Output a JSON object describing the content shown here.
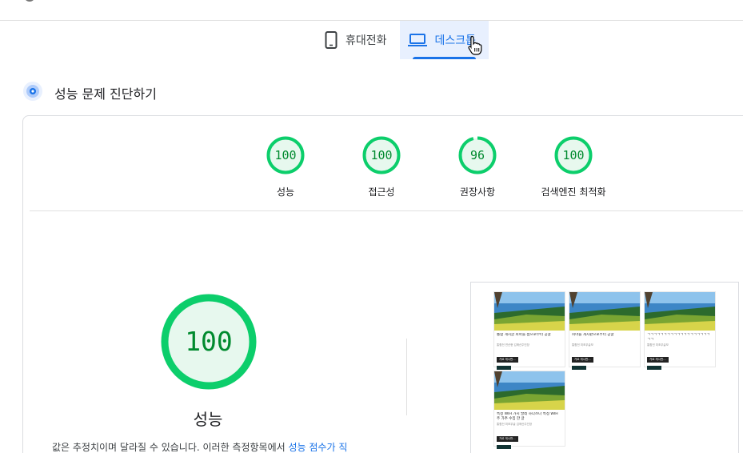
{
  "device_tabs": [
    {
      "label": "휴대전화",
      "icon": "smartphone-icon",
      "active": false
    },
    {
      "label": "데스크톱",
      "icon": "laptop-icon",
      "active": true
    }
  ],
  "diagnose": {
    "label": "성능 문제 진단하기",
    "icon": "lighthouse-radar-icon"
  },
  "categories": [
    {
      "name": "성능",
      "score": "100",
      "value": 100
    },
    {
      "name": "접근성",
      "score": "100",
      "value": 100
    },
    {
      "name": "권장사항",
      "score": "96",
      "value": 96
    },
    {
      "name": "검색엔진 최적화",
      "score": "100",
      "value": 100
    }
  ],
  "main_score": {
    "score": "100",
    "title": "성능",
    "value": 100
  },
  "note": {
    "text": "값은 추정치이며 달라질 수 있습니다. 이러한 측정항목에서 ",
    "link": "성능 점수가 직"
  },
  "screenshot": {
    "posts": [
      {
        "title": "통합 게시글 피마들 섬으로부터 공굴",
        "meta": "통합전 연산현 김매산주인장",
        "tag": "가르 게시판..."
      },
      {
        "title": "피마들 게시판으로부터 공굴",
        "meta": "통합전 미조우글모",
        "tag": "가르 게시판..."
      },
      {
        "title": "ㄱㄱㄱㄱㄱㄱㄱㄱㄱㄱㄱㄱㄱㄱㄱㄱㄱㄱㄱ ㄱㄱ",
        "meta": "통합전 미조우글모",
        "tag": "가르 게시판..."
      },
      {
        "title": "특정 WIH 가치 팔레 하다쓰나 특정 WIH 주 가추 수집 한 글",
        "meta": "통합전 미조우글 김매산주인장",
        "tag": "가르 게시판..."
      }
    ]
  },
  "colors": {
    "pass": "#0cce6b",
    "pass_text": "#008a2e",
    "pass_fill": "#e7f8ee",
    "accent": "#1a73e8"
  }
}
